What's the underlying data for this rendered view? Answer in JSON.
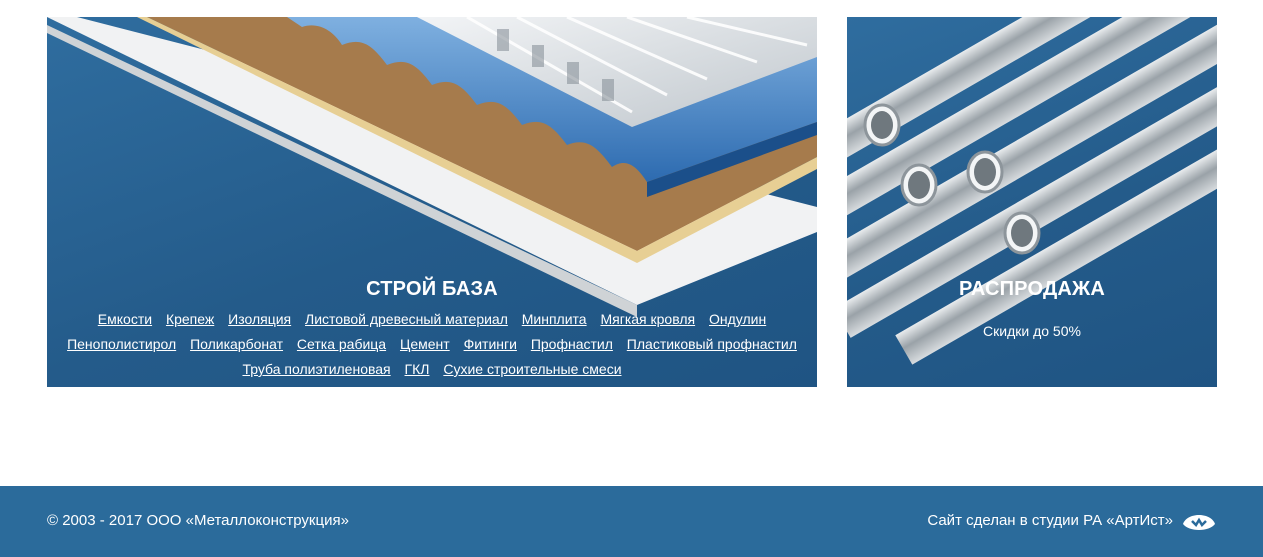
{
  "stroy": {
    "title": "СТРОЙ БАЗА",
    "links": [
      "Емкости",
      "Крепеж",
      "Изоляция",
      "Листовой древесный материал",
      "Минплита",
      "Мягкая кровля",
      "Ондулин",
      "Пенополистирол",
      "Поликарбонат",
      "Сетка рабица",
      "Цемент",
      "Фитинги",
      "Профнастил",
      "Пластиковый профнастил",
      "Труба полиэтиленовая",
      "ГКЛ",
      "Сухие строительные смеси"
    ]
  },
  "sale": {
    "title": "РАСПРОДАЖА",
    "subtitle": "Скидки до 50%"
  },
  "footer": {
    "copyright": "© 2003 - 2017 ООО «Металлоконструкция»",
    "studio_text": "Сайт сделан в студии РА «АртИст»",
    "studio_icon": "artist-logo-icon"
  },
  "colors": {
    "card_blue": "#245b8a",
    "footer_blue": "#2b6b9b"
  }
}
